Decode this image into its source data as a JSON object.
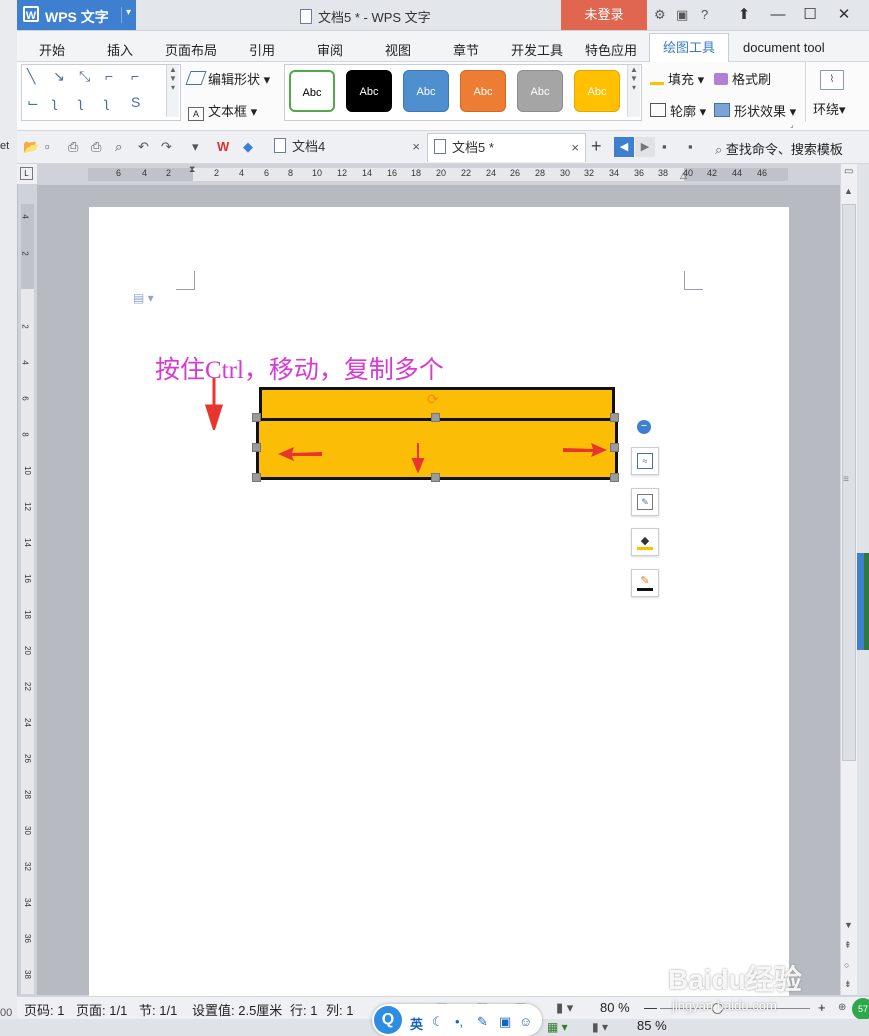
{
  "window": {
    "app_name": "WPS 文字",
    "title": "文档5 * - WPS 文字",
    "login_label": "未登录"
  },
  "menu": {
    "tabs": [
      "开始",
      "插入",
      "页面布局",
      "引用",
      "审阅",
      "视图",
      "章节",
      "开发工具",
      "特色应用",
      "绘图工具",
      "document tool"
    ],
    "active_tab": "绘图工具"
  },
  "ribbon": {
    "edit_shape": "编辑形状",
    "text_box": "文本框",
    "style_swatches": [
      {
        "label": "Abc",
        "bg": "#ffffff",
        "fg": "#000000",
        "border": "#52a84a"
      },
      {
        "label": "Abc",
        "bg": "#000000",
        "fg": "#ffffff",
        "border": "#000000"
      },
      {
        "label": "Abc",
        "bg": "#4f8fd0",
        "fg": "#ffffff",
        "border": "#3a78b8"
      },
      {
        "label": "Abc",
        "bg": "#ec7d32",
        "fg": "#ffffff",
        "border": "#d0681f"
      },
      {
        "label": "Abc",
        "bg": "#a5a5a5",
        "fg": "#ffffff",
        "border": "#8c8c8c"
      },
      {
        "label": "Abc",
        "bg": "#ffc000",
        "fg": "#ffffff",
        "border": "#e0a800"
      }
    ],
    "fill": "填充",
    "format_painter": "格式刷",
    "outline": "轮廓",
    "shape_effect": "形状效果",
    "wrap": "环绕"
  },
  "doc_tabs": {
    "tab1": "文档4",
    "tab2": "文档5 *",
    "search": "查找命令、搜索模板"
  },
  "ruler": {
    "h_ticks": [
      "6",
      "4",
      "2",
      "2",
      "4",
      "6",
      "8",
      "10",
      "12",
      "14",
      "16",
      "18",
      "20",
      "22",
      "24",
      "26",
      "28",
      "30",
      "32",
      "34",
      "36",
      "38",
      "40",
      "42",
      "44",
      "46"
    ],
    "v_ticks": [
      "4",
      "2",
      "2",
      "4",
      "6",
      "8",
      "10",
      "12",
      "14",
      "16",
      "18",
      "20",
      "22",
      "24",
      "26",
      "28",
      "30",
      "32",
      "34",
      "36",
      "38"
    ]
  },
  "document": {
    "annotation": "按住Ctrl，移动，复制多个",
    "shape_color": "#fbbd06",
    "arrow_color": "#e8352e",
    "annotation_color": "#d63ad6"
  },
  "status": {
    "page_code": "页码: 1",
    "page": "页面: 1/1",
    "section": "节: 1/1",
    "setting": "设置值: 2.5厘米",
    "row": "行: 1",
    "col": "列: 1",
    "zoom": "80 %",
    "taskbar_zoom": "85 %"
  },
  "ime": {
    "lang": "英"
  },
  "watermark": {
    "brand": "Baidu经验",
    "url": "jingyan.baidu.com"
  }
}
